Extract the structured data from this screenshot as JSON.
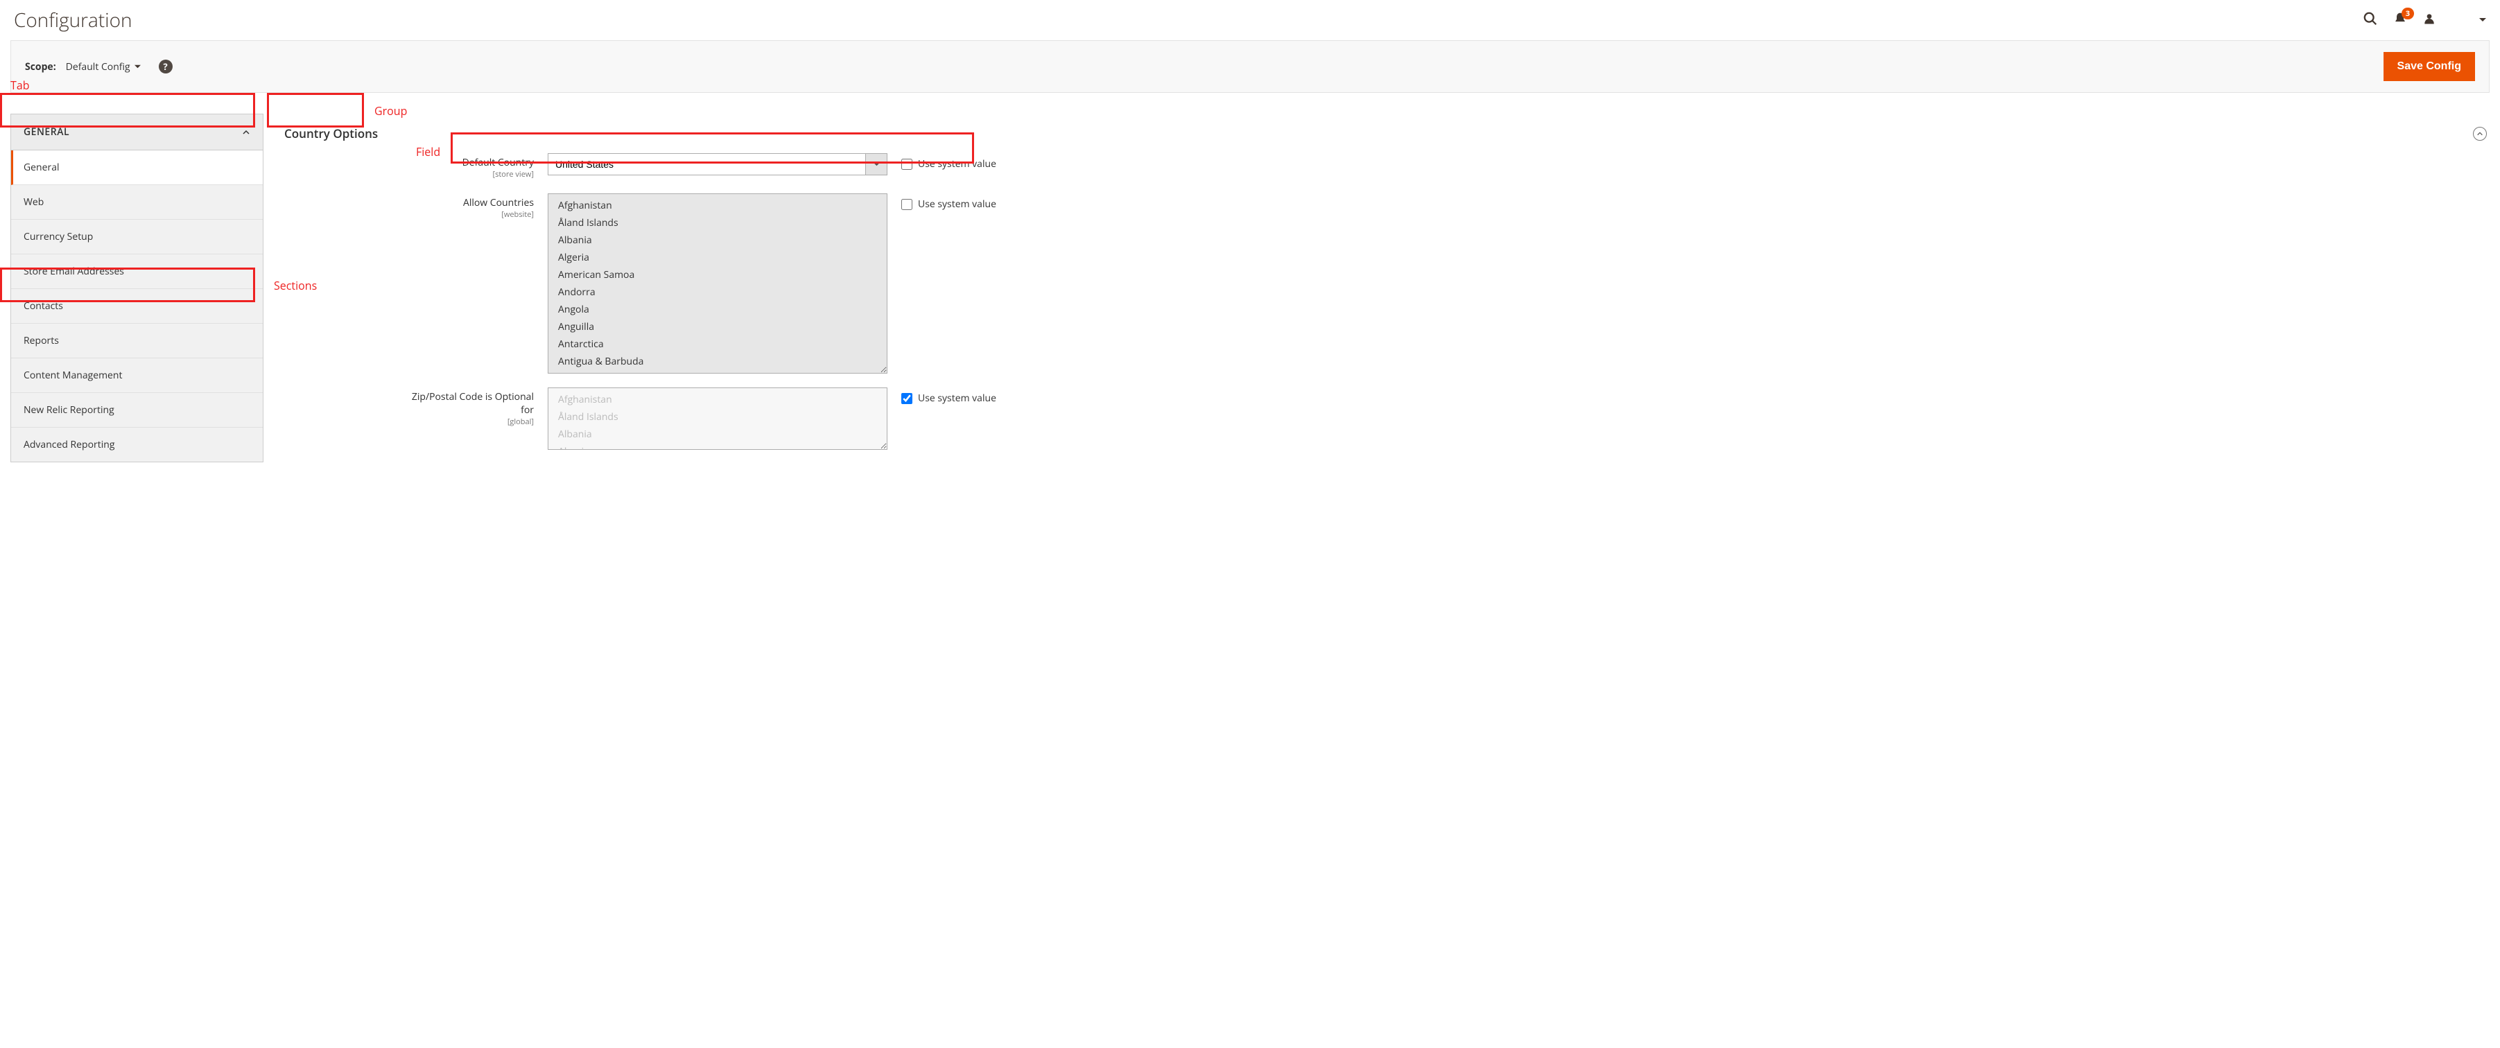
{
  "page": {
    "title": "Configuration"
  },
  "header": {
    "notif_count": "3"
  },
  "scopebar": {
    "label": "Scope:",
    "value": "Default Config",
    "save_label": "Save Config"
  },
  "sidebar": {
    "tab_label": "GENERAL",
    "sections": [
      {
        "label": "General"
      },
      {
        "label": "Web"
      },
      {
        "label": "Currency Setup"
      },
      {
        "label": "Store Email Addresses"
      },
      {
        "label": "Contacts"
      },
      {
        "label": "Reports"
      },
      {
        "label": "Content Management"
      },
      {
        "label": "New Relic Reporting"
      },
      {
        "label": "Advanced Reporting"
      }
    ]
  },
  "group": {
    "title": "Country Options"
  },
  "fields": {
    "default_country": {
      "label": "Default Country",
      "scope": "[store view]",
      "value": "United States",
      "sys_label": "Use system value"
    },
    "allow_countries": {
      "label": "Allow Countries",
      "scope": "[website]",
      "sys_label": "Use system value"
    },
    "zip_optional": {
      "label": "Zip/Postal Code is Optional for",
      "scope": "[global]",
      "sys_label": "Use system value"
    }
  },
  "countries": [
    "Afghanistan",
    "Åland Islands",
    "Albania",
    "Algeria",
    "American Samoa",
    "Andorra",
    "Angola",
    "Anguilla",
    "Antarctica",
    "Antigua & Barbuda"
  ],
  "countries_disabled": [
    "Afghanistan",
    "Åland Islands",
    "Albania",
    "Algeria"
  ],
  "annot": {
    "tab": "Tab",
    "group": "Group",
    "field": "Field",
    "sections": "Sections"
  }
}
